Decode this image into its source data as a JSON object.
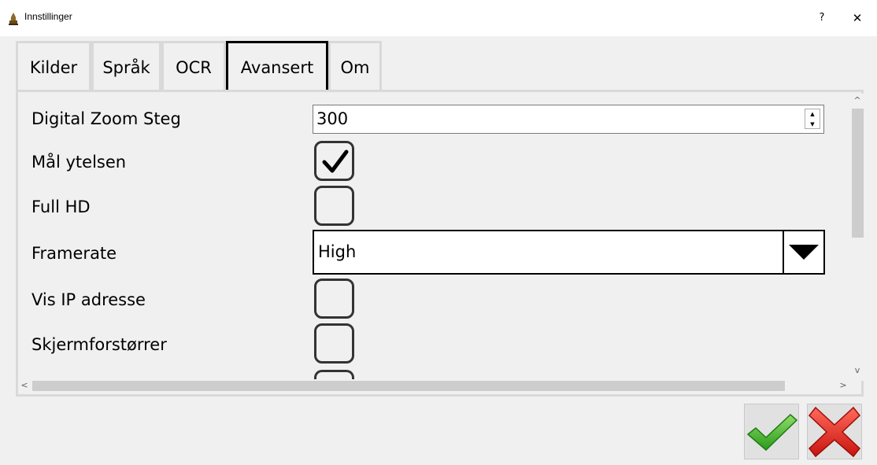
{
  "window": {
    "title": "Innstillinger",
    "help_label": "?",
    "close_label": "✕"
  },
  "tabs": [
    {
      "label": "Kilder",
      "active": false
    },
    {
      "label": "Språk",
      "active": false
    },
    {
      "label": "OCR",
      "active": false
    },
    {
      "label": "Avansert",
      "active": true
    },
    {
      "label": "Om",
      "active": false
    }
  ],
  "settings": {
    "digital_zoom": {
      "label": "Digital Zoom Steg",
      "value": "300"
    },
    "measure_performance": {
      "label": "Mål ytelsen",
      "checked": true
    },
    "full_hd": {
      "label": "Full HD",
      "checked": false
    },
    "framerate": {
      "label": "Framerate",
      "value": "High"
    },
    "show_ip": {
      "label": "Vis IP adresse",
      "checked": false
    },
    "magnifier": {
      "label": "Skjermforstørrer",
      "checked": false
    }
  },
  "icons": {
    "app": "flame-icon",
    "ok": "green-check-icon",
    "cancel": "red-x-icon"
  },
  "colors": {
    "ok_green": "#3cae1e",
    "cancel_red": "#e0201e"
  }
}
